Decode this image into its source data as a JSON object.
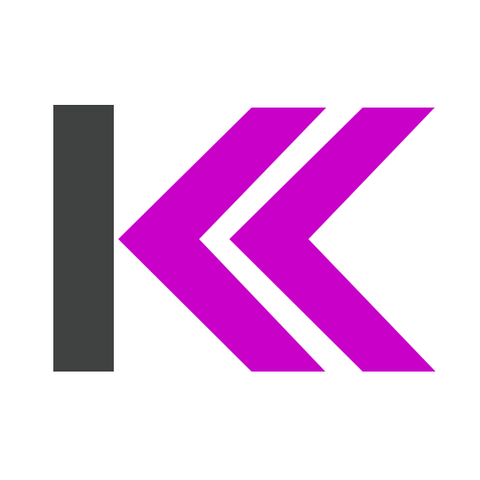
{
  "app_icon": {
    "icon": "k-chevrons-logo-icon",
    "colors": {
      "background": "#ffffff",
      "bar": "#404242",
      "chevrons": "#c800c8"
    }
  }
}
